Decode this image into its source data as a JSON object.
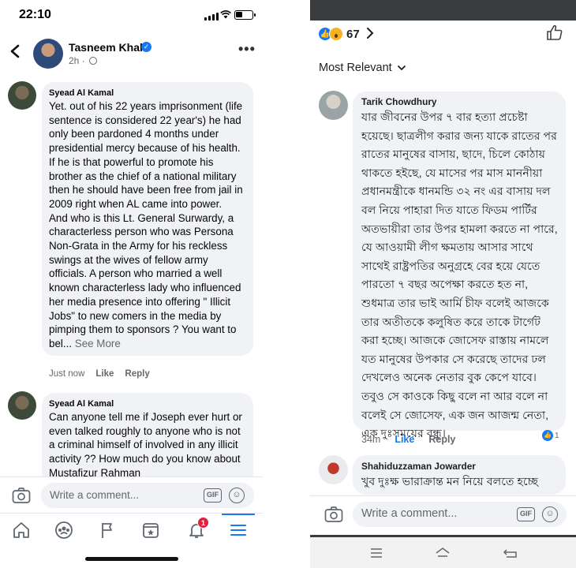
{
  "left": {
    "status_time": "22:10",
    "post": {
      "author": "Tasneem Khalil",
      "meta": "2h ·"
    },
    "comments": [
      {
        "name": "Syead Al Kamal",
        "text": "Yet. out of his 22 years imprisonment (life sentence is considered 22 year's) he had only been pardoned 4 months under presidential mercy because of his health. If he is that powerful to promote his brother as the chief of a national military then he should have been free from jail in 2009 right when AL came into power.\nAnd who is this Lt. General Surwardy, a characterless person who was Persona Non-Grata in the Army for his reckless swings at the wives of fellow army officials. A person who married a well known characterless lady who influenced her media presence into offering \" Illicit Jobs\" to new comers in the media by pimping them to sponsors ? You want to bel...",
        "see_more": "See More",
        "time": "Just now",
        "like": "Like",
        "reply": "Reply"
      },
      {
        "name": "Syead Al Kamal",
        "text": "Can anyone tell me if Joseph ever hurt or even talked roughly to anyone who is not a criminal himself of involved in any illicit activity ?? How much do you know about Mustafizur Rahman"
      }
    ],
    "composer_placeholder": "Write a comment...",
    "gif_label": "GIF",
    "notification_count": "1",
    "tabs": [
      "home-icon",
      "groups-icon",
      "pages-flag-icon",
      "marketplace-icon",
      "notifications-bell-icon",
      "menu-icon"
    ]
  },
  "right": {
    "reaction_count": "67",
    "sort_label": "Most Relevant",
    "comments": [
      {
        "name": "Tarik Chowdhury",
        "text": "যার জীবনের উপর ৭ বার হত্যা প্রচেষ্টা হয়েছে। ছাত্রলীগ করার জন্য যাকে রাতের পর রাতের মানুষের বাসায়, ছাদে, চিলে কোঠায় থাকতে হইছে, যে মাসের পর মাস মাননীয়া প্রধানমন্ত্রীকে ধানমন্ডি ৩২ নং এর বাসায় দল বল নিয়ে পাহারা দিত যাতে ফিডম পার্টির অতভায়ীরা তার উপর হামলা করতে না পারে, যে আওয়ামী লীগ ক্ষমতায় আসার সাথে সাথেই রাষ্ট্রপতির অনুগ্রহে বের হয়ে যেতে পারতো ৭ বছর অপেক্ষা করতে হত না, শুধমাত্র তার ভাই আর্মি চীফ বলেই আজকে তার অতীতকে কলুষিত করে তাকে টার্গেট করা হচ্ছে। আজকে জোসেফ রাস্তায় নামলে যত মানুষের উপকার সে করেছে তাদের ঢল দেখলেও অনেক নেতার বুক কেপে যাবে। তবুও সে কাওকে কিছু বলে না আর বলে না বলেই সে জোসেফ, এক জন আজন্ম নেতা, এক দুঃসময়ের বন্ধু।",
        "time": "34m",
        "like": "Like",
        "reply": "Reply",
        "reactions": "1"
      },
      {
        "name": "Shahiduzzaman Jowarder",
        "text": "খুব দুঃক্ষ ভারাক্রান্ত মন নিয়ে বলতে হচ্ছে"
      }
    ],
    "composer_placeholder": "Write a comment...",
    "gif_label": "GIF"
  },
  "colors": {
    "accent": "#1877f2",
    "bubble": "#f0f2f5",
    "badge": "#e41e3f"
  }
}
